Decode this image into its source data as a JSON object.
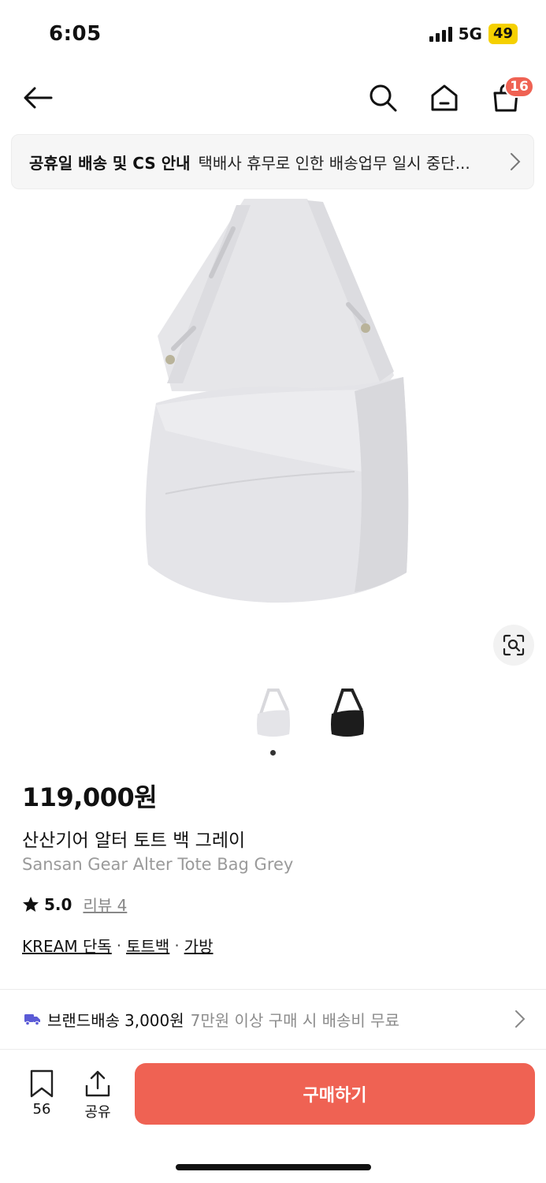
{
  "status_bar": {
    "time": "6:05",
    "network": "5G",
    "battery": "49"
  },
  "nav": {
    "cart_badge": "16"
  },
  "notice": {
    "title": "공휴일 배송 및 CS 안내",
    "text": "택배사 휴무로 인한 배송업무 일시 중단..."
  },
  "product": {
    "price": "119,000원",
    "name_ko": "산산기어 알터 토트 백 그레이",
    "name_en": "Sansan Gear Alter Tote Bag Grey",
    "rating": "5.0",
    "reviews": "리뷰 4",
    "tags": [
      "KREAM 단독",
      "토트백",
      "가방"
    ],
    "tag_separator": "·"
  },
  "shipping": {
    "label": "브랜드배송",
    "fee": "3,000원",
    "note": "7만원 이상 구매 시 배송비 무료"
  },
  "bottom_bar": {
    "bookmark_count": "56",
    "share_label": "공유",
    "buy_label": "구매하기"
  },
  "colors": {
    "accent": "#ef6253",
    "badge": "#ef6253",
    "battery": "#f5d000",
    "truck": "#5b5bd6"
  },
  "icons": [
    "back-arrow-icon",
    "search-icon",
    "home-icon",
    "shopping-bag-icon",
    "chevron-right-icon",
    "lens-search-icon",
    "star-icon",
    "truck-icon",
    "bookmark-icon",
    "share-icon"
  ]
}
